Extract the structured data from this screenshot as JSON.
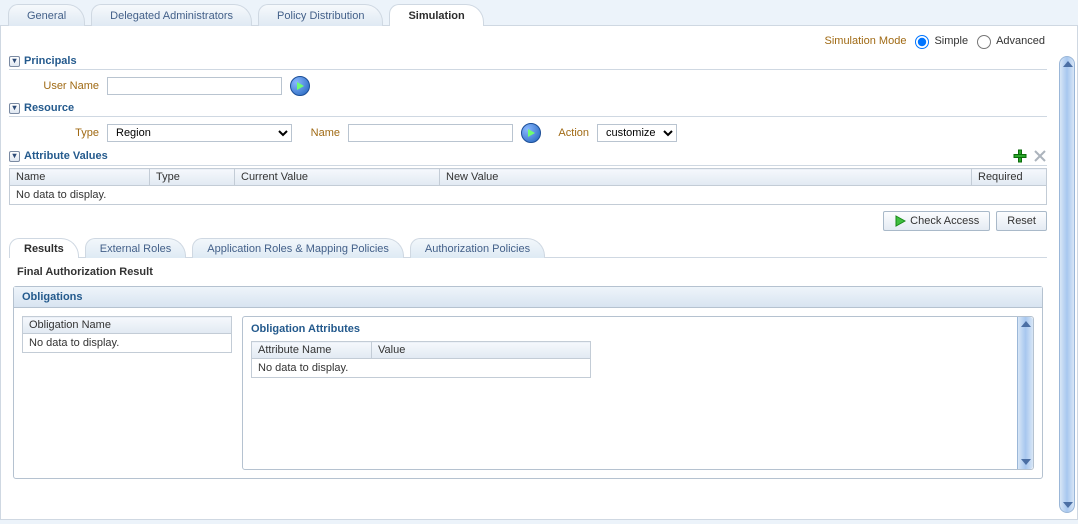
{
  "tabs": {
    "main": [
      "General",
      "Delegated Administrators",
      "Policy Distribution",
      "Simulation"
    ],
    "active": 3,
    "sub": [
      "Results",
      "External Roles",
      "Application Roles & Mapping Policies",
      "Authorization Policies"
    ],
    "subactive": 0
  },
  "simmode": {
    "label": "Simulation Mode",
    "simple": "Simple",
    "advanced": "Advanced",
    "selected": "simple"
  },
  "principals": {
    "title": "Principals",
    "username_label": "User Name",
    "username_value": ""
  },
  "resource": {
    "title": "Resource",
    "type_label": "Type",
    "type_options": [
      "Region"
    ],
    "type_value": "Region",
    "name_label": "Name",
    "name_value": "",
    "action_label": "Action",
    "action_options": [
      "customize"
    ],
    "action_value": "customize"
  },
  "attrvalues": {
    "title": "Attribute Values",
    "columns": [
      "Name",
      "Type",
      "Current Value",
      "New Value",
      "Required"
    ],
    "nodata": "No data to display."
  },
  "buttons": {
    "check": "Check Access",
    "reset": "Reset"
  },
  "result": {
    "heading": "Final Authorization Result",
    "obligations_title": "Obligations",
    "obl_name_col": "Obligation Name",
    "obl_nodata": "No data to display.",
    "attr_title": "Obligation Attributes",
    "attr_cols": [
      "Attribute Name",
      "Value"
    ],
    "attr_nodata": "No data to display."
  }
}
